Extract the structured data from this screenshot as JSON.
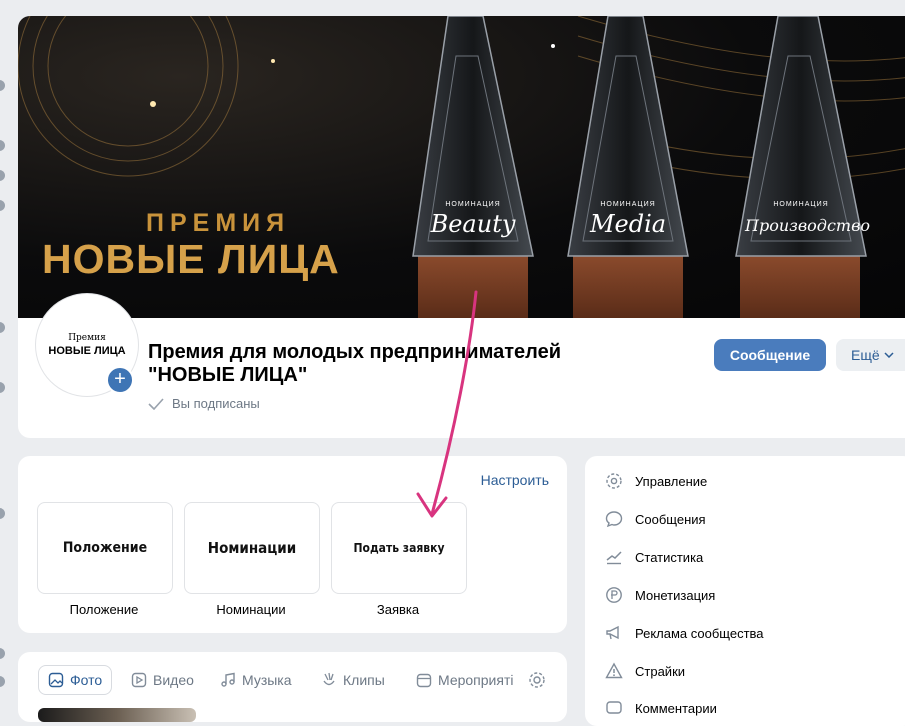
{
  "cover": {
    "premia": "ПРЕМИЯ",
    "title": "НОВЫЕ ЛИЦА",
    "trophies": [
      {
        "nomination": "НОМИНАЦИЯ",
        "category": "Beauty"
      },
      {
        "nomination": "НОМИНАЦИЯ",
        "category": "Media"
      },
      {
        "nomination": "НОМИНАЦИЯ",
        "category": "Производство"
      }
    ]
  },
  "avatar": {
    "line1": "Премия",
    "line2": "НОВЫЕ ЛИЦА",
    "add_symbol": "+"
  },
  "group": {
    "name": "Премия для молодых предпринимателей \"НОВЫЕ ЛИЦА\"",
    "status": "Вы подписаны"
  },
  "actions": {
    "message": "Сообщение",
    "more": "Ещё"
  },
  "widgets": {
    "configure": "Настроить",
    "tiles": [
      {
        "text": "Положение",
        "caption": "Положение"
      },
      {
        "text": "Номинации",
        "caption": "Номинации"
      },
      {
        "text": "Подать заявку",
        "caption": "Заявка"
      }
    ]
  },
  "media_tabs": [
    "Фото",
    "Видео",
    "Музыка",
    "Клипы",
    "Мероприяті"
  ],
  "menu": [
    {
      "label": "Управление",
      "icon": "gear-icon"
    },
    {
      "label": "Сообщения",
      "icon": "chat-bubble-icon"
    },
    {
      "label": "Статистика",
      "icon": "trend-chart-icon"
    },
    {
      "label": "Монетизация",
      "icon": "coin-icon"
    },
    {
      "label": "Реклама сообщества",
      "icon": "megaphone-icon"
    },
    {
      "label": "Страйки",
      "icon": "warning-icon"
    },
    {
      "label": "Комментарии",
      "icon": "comment-icon"
    }
  ],
  "colors": {
    "accent": "#4a7cbd",
    "link": "#2c5d95",
    "annotation_arrow": "#d8347f",
    "gold": "#d6a14a"
  }
}
